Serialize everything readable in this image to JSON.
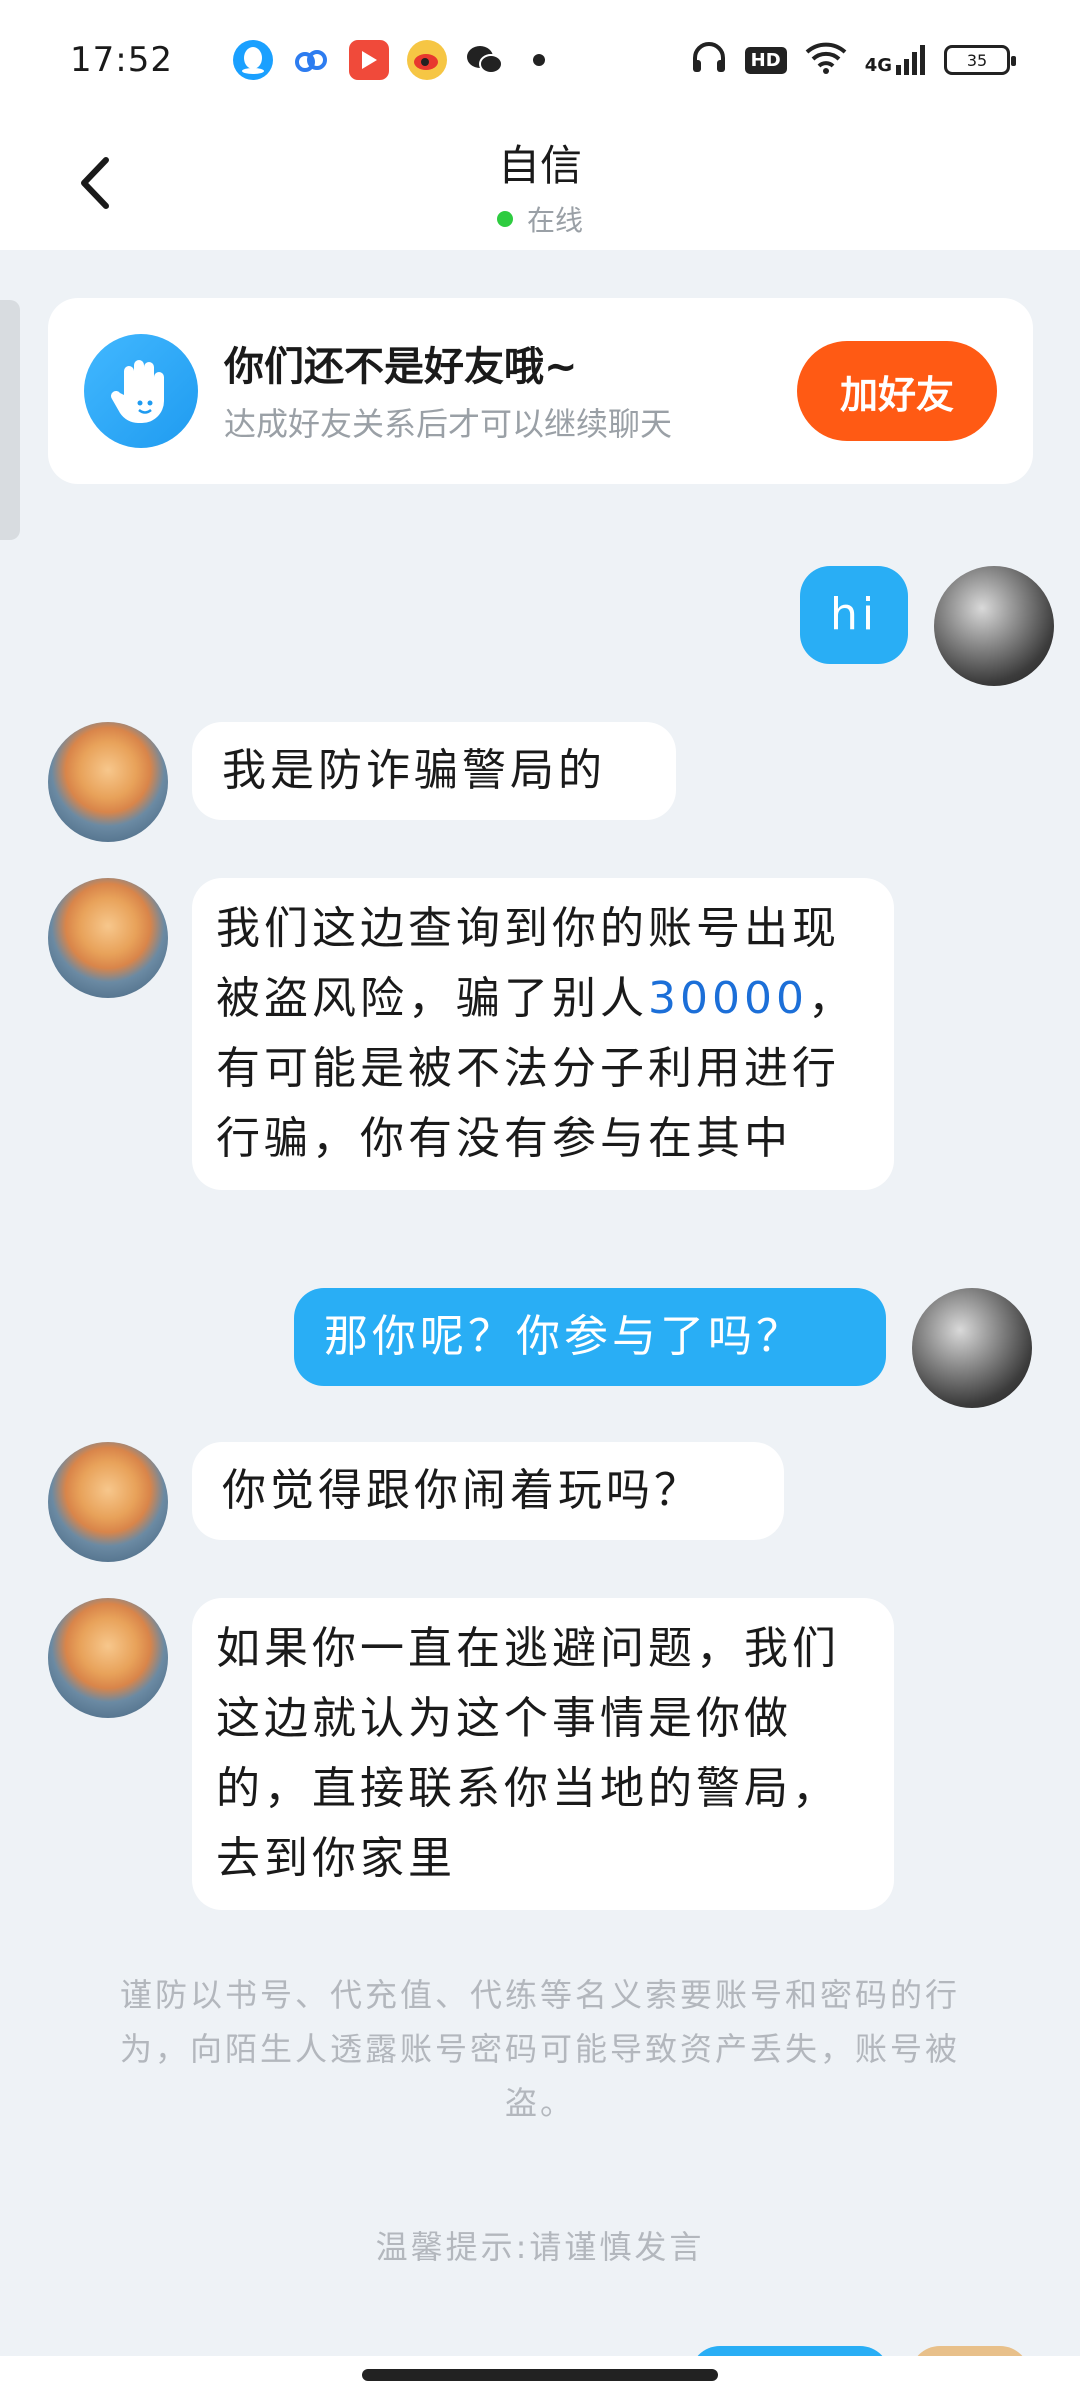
{
  "status_bar": {
    "time": "17:52",
    "battery": "35",
    "hd": "HD",
    "network": "4G",
    "icons": [
      "qq-icon",
      "cloud-icon",
      "video-icon",
      "weibo-icon",
      "wechat-icon",
      "headphones-icon",
      "wifi-icon",
      "signal-icon"
    ]
  },
  "header": {
    "title": "自信",
    "status": "在线"
  },
  "friend_banner": {
    "title": "你们还不是好友哦~",
    "subtitle": "达成好友关系后才可以继续聊天",
    "button": "加好友"
  },
  "messages": [
    {
      "side": "out",
      "text": "hi"
    },
    {
      "side": "in",
      "text": "我是防诈骗警局的"
    },
    {
      "side": "in",
      "text_before": "我们这边查询到你的账号出现被盗风险，骗了别人",
      "highlight": "30000",
      "text_after": "，有可能是被不法分子利用进行行骗，你有没有参与在其中"
    },
    {
      "side": "out",
      "text": "那你呢？你参与了吗？"
    },
    {
      "side": "in",
      "text": "你觉得跟你闹着玩吗？"
    },
    {
      "side": "in",
      "text": "如果你一直在逃避问题，我们这边就认为这个事情是你做的，直接联系你当地的警局，去到你家里"
    }
  ],
  "notice": "谨防以书号、代充值、代练等名义索要账号和密码的行为，向陌生人透露账号密码可能导致资产丢失，账号被盗。",
  "tip": "温馨提示:请谨慎发言",
  "colors": {
    "accent_blue": "#29aef5",
    "add_friend_orange": "#ff5a14",
    "online_green": "#2ecc40"
  }
}
